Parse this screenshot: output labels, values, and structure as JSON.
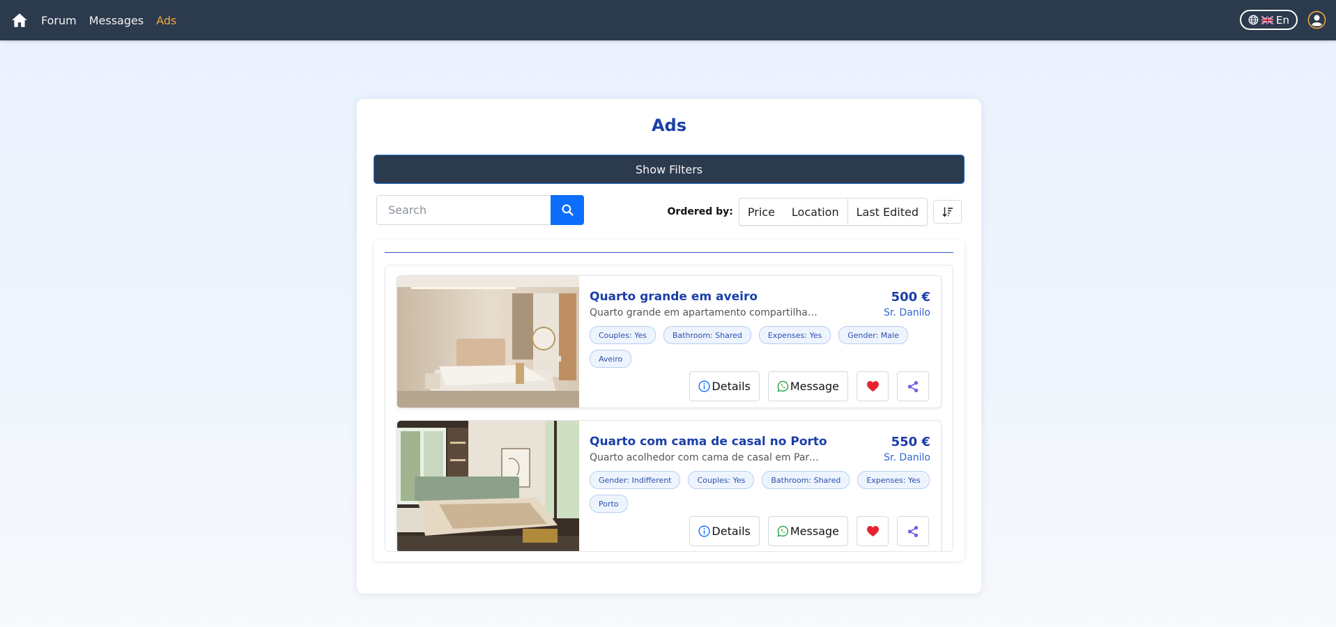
{
  "nav": {
    "links": [
      {
        "label": "Forum"
      },
      {
        "label": "Messages"
      },
      {
        "label": "Ads",
        "active": true
      }
    ],
    "language": "En",
    "accent": "#f0a93b"
  },
  "main": {
    "title": "Ads",
    "show_filters_label": "Show Filters",
    "search": {
      "placeholder": "Search"
    },
    "ordered_by_label": "Ordered by:",
    "order_options": [
      "Price",
      "Location",
      "Last Edited"
    ]
  },
  "ads": [
    {
      "title": "Quarto grande em aveiro",
      "description": "Quarto grande em apartamento compartilhado c...",
      "price": "500 €",
      "author": "Sr. Danilo",
      "tags": [
        "Couples: Yes",
        "Bathroom: Shared",
        "Expenses: Yes",
        "Gender: Male",
        "Aveiro"
      ],
      "actions": {
        "details": "Details",
        "message": "Message"
      }
    },
    {
      "title": "Quarto com cama de casal no Porto",
      "description": "Quarto acolhedor com cama de casal em Paredes,...",
      "price": "550 €",
      "author": "Sr. Danilo",
      "tags": [
        "Gender: Indifferent",
        "Couples: Yes",
        "Bathroom: Shared",
        "Expenses: Yes",
        "Porto"
      ],
      "actions": {
        "details": "Details",
        "message": "Message"
      }
    }
  ],
  "colors": {
    "navbar": "#2c3a4d",
    "title_blue": "#1a3fa8",
    "search_button": "#0d6efd",
    "heart": "#e8232f",
    "share": "#6f63e0",
    "whatsapp": "#25a244"
  },
  "icons": [
    "home-icon",
    "globe-icon",
    "uk-flag-icon",
    "user-circle-icon",
    "search-icon",
    "sort-desc-icon",
    "info-icon",
    "whatsapp-icon",
    "heart-icon",
    "share-icon"
  ]
}
